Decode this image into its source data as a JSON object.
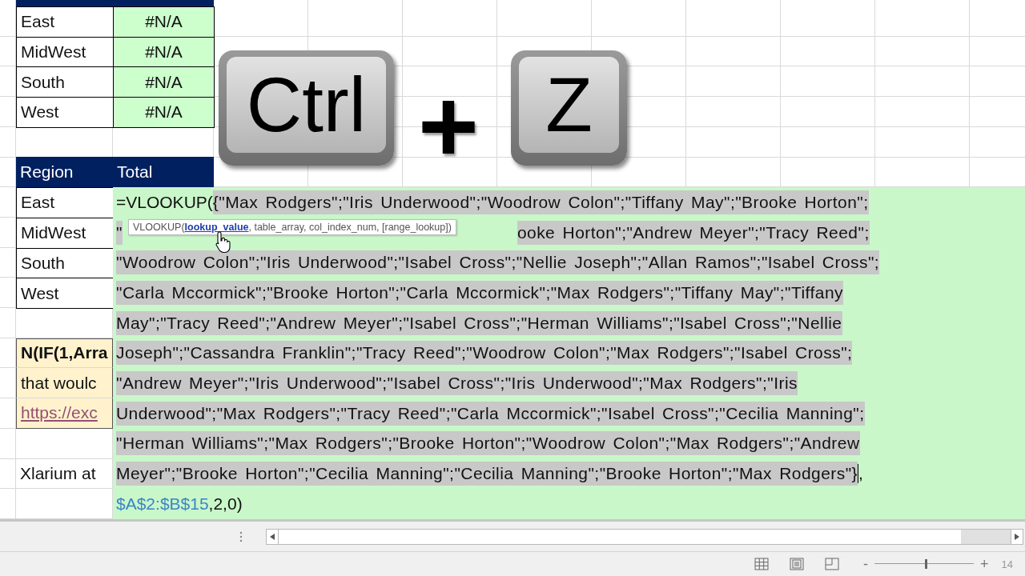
{
  "top_table": {
    "rows": [
      {
        "region": "East",
        "total": "#N/A"
      },
      {
        "region": "MidWest",
        "total": "#N/A"
      },
      {
        "region": "South",
        "total": "#N/A"
      },
      {
        "region": "West",
        "total": "#N/A"
      }
    ]
  },
  "keys": [
    {
      "kind": "key",
      "label": "Ctrl"
    },
    {
      "kind": "plus",
      "label": "+"
    },
    {
      "kind": "key",
      "label": "Z"
    }
  ],
  "second_table": {
    "columns": [
      "Region",
      "Total"
    ],
    "rows": [
      "East",
      "MidWest",
      "South",
      "West"
    ]
  },
  "notes": [
    {
      "kind": "bold",
      "text": "N(IF(1,Arra"
    },
    {
      "kind": "plain",
      "text": "that woulc"
    },
    {
      "kind": "link",
      "text": "https://exc"
    }
  ],
  "footer_note": "Xlarium at",
  "formula": {
    "prefix": "=VLOOKUP(",
    "lines": [
      {
        "kind": "full",
        "text": "{\"Max Rodgers\";\"Iris Underwood\";\"Woodrow Colon\";\"Tiffany May\";\"Brooke Horton\";"
      },
      {
        "kind": "covered",
        "lead": "\"",
        "text": "ooke Horton\";\"Andrew Meyer\";\"Tracy Reed\";"
      },
      {
        "kind": "full",
        "text": "\"Woodrow Colon\";\"Iris Underwood\";\"Isabel Cross\";\"Nellie Joseph\";\"Allan Ramos\";\"Isabel Cross\";"
      },
      {
        "kind": "full",
        "text": "\"Carla Mccormick\";\"Brooke Horton\";\"Carla Mccormick\";\"Max Rodgers\";\"Tiffany May\";\"Tiffany"
      },
      {
        "kind": "full",
        "text": "May\";\"Tracy Reed\";\"Andrew Meyer\";\"Isabel Cross\";\"Herman Williams\";\"Isabel Cross\";\"Nellie"
      },
      {
        "kind": "full",
        "text": "Joseph\";\"Cassandra Franklin\";\"Tracy Reed\";\"Woodrow Colon\";\"Max Rodgers\";\"Isabel Cross\";"
      },
      {
        "kind": "full",
        "text": "\"Andrew Meyer\";\"Iris Underwood\";\"Isabel Cross\";\"Iris Underwood\";\"Max Rodgers\";\"Iris"
      },
      {
        "kind": "full",
        "text": "Underwood\";\"Max Rodgers\";\"Tracy Reed\";\"Carla Mccormick\";\"Isabel Cross\";\"Cecilia Manning\";"
      },
      {
        "kind": "full",
        "text": "\"Herman Williams\";\"Max Rodgers\";\"Brooke Horton\";\"Woodrow Colon\";\"Max Rodgers\";\"Andrew"
      },
      {
        "kind": "full",
        "text": "Meyer\";\"Brooke Horton\";\"Cecilia Manning\";\"Cecilia Manning\";\"Brooke Horton\";\"Max Rodgers\"}"
      }
    ],
    "suffix": ",",
    "reference": "$A$2:$B$15",
    "tail": ",2,0)"
  },
  "tooltip": {
    "function": "VLOOKUP(",
    "current_arg": "lookup_value",
    "rest": ", table_array, col_index_num, [range_lookup])"
  },
  "status_bar": {
    "zoom_out": "-",
    "zoom_in": "+",
    "zoom_level": "14",
    "level": 0.52
  }
}
